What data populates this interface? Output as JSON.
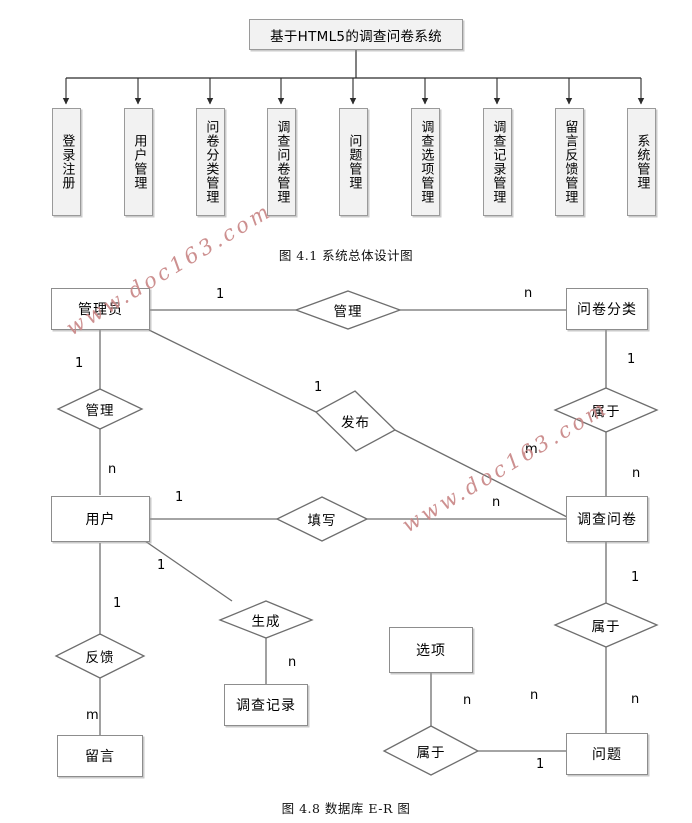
{
  "figure1": {
    "caption": "图 4.1    系统总体设计图",
    "root": {
      "label": "基于HTML5的调查问卷系统"
    },
    "nodes": [
      {
        "label": "登录注册"
      },
      {
        "label": "用户管理"
      },
      {
        "label": "问卷分类管理"
      },
      {
        "label": "调查问卷管理"
      },
      {
        "label": "问题管理"
      },
      {
        "label": "调查选项管理"
      },
      {
        "label": "调查记录管理"
      },
      {
        "label": "留言反馈管理"
      },
      {
        "label": "系统管理"
      }
    ]
  },
  "figure2": {
    "caption": "图 4.8 数据库 E-R 图",
    "entities": [
      {
        "label": "管理员"
      },
      {
        "label": "问卷分类"
      },
      {
        "label": "用户"
      },
      {
        "label": "调查问卷"
      },
      {
        "label": "调查记录"
      },
      {
        "label": "留言"
      },
      {
        "label": "选项"
      },
      {
        "label": "问题"
      }
    ],
    "relationships": [
      {
        "label": "管理"
      },
      {
        "label": "管理"
      },
      {
        "label": "发布"
      },
      {
        "label": "属于"
      },
      {
        "label": "填写"
      },
      {
        "label": "生成"
      },
      {
        "label": "反馈"
      },
      {
        "label": "属于"
      },
      {
        "label": "属于"
      }
    ],
    "cardinalities": [
      {
        "label": "1"
      },
      {
        "label": "n"
      },
      {
        "label": "1"
      },
      {
        "label": "n"
      },
      {
        "label": "1"
      },
      {
        "label": "1"
      },
      {
        "label": "m"
      },
      {
        "label": "1"
      },
      {
        "label": "n"
      },
      {
        "label": "n"
      },
      {
        "label": "1"
      },
      {
        "label": "n"
      },
      {
        "label": "1"
      },
      {
        "label": "m"
      },
      {
        "label": "1"
      },
      {
        "label": "n"
      },
      {
        "label": "n"
      },
      {
        "label": "n"
      },
      {
        "label": "1"
      }
    ]
  },
  "watermarks": [
    {
      "text": "www.doc163.com"
    },
    {
      "text": "www.doc163.com"
    }
  ],
  "colors": {
    "box_fill": "#f2f2f2",
    "box_border": "#9a9a9a",
    "entity_border": "#8d8d8d",
    "line": "#6e6e6e",
    "watermark": "#c98787"
  }
}
